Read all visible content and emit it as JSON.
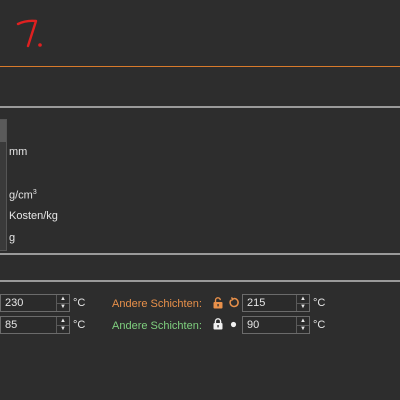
{
  "annotation": {
    "text": "7.",
    "color": "#e02020"
  },
  "units": {
    "diameter": "mm",
    "density_base": "g/cm",
    "density_sup": "3",
    "cost": "Kosten/kg",
    "weight": "g"
  },
  "temperatures": {
    "row1": {
      "first_layer_value": "230",
      "first_layer_unit": "°C",
      "other_label": "Andere Schichten:",
      "other_value": "215",
      "other_unit": "°C",
      "lock_icon": "lock-open-icon",
      "reset_icon": "reset-icon"
    },
    "row2": {
      "first_layer_value": "85",
      "first_layer_unit": "°C",
      "other_label": "Andere Schichten:",
      "other_value": "90",
      "other_unit": "°C",
      "lock_icon": "lock-closed-icon",
      "reset_icon": "dot-icon"
    }
  },
  "colors": {
    "accent_orange": "#d87a2b",
    "label_orange": "#e8904a",
    "label_green": "#7fd07f",
    "background": "#2d2d2d"
  }
}
